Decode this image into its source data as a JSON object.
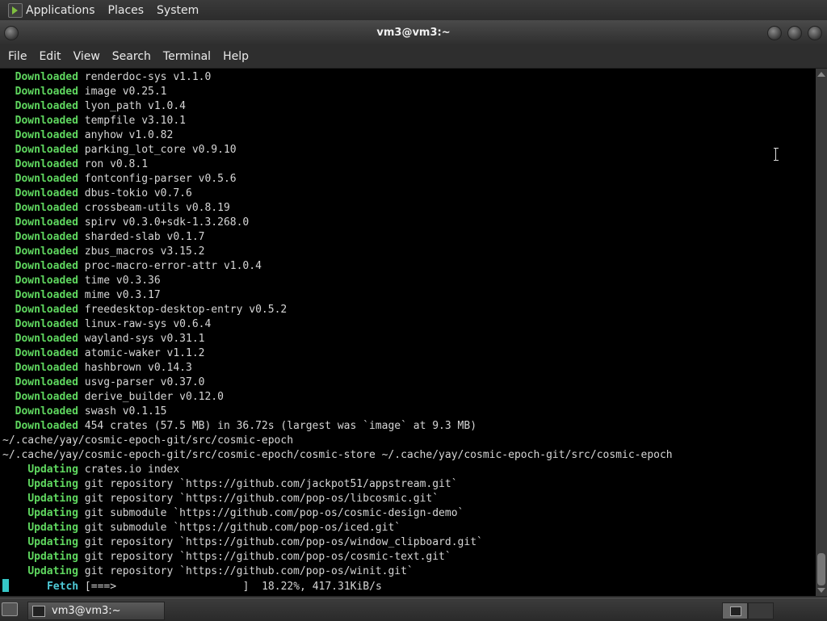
{
  "top_panel": {
    "menus": [
      "Applications",
      "Places",
      "System"
    ]
  },
  "window": {
    "title": "vm3@vm3:~"
  },
  "menubar": {
    "items": [
      "File",
      "Edit",
      "View",
      "Search",
      "Terminal",
      "Help"
    ]
  },
  "terminal": {
    "lines": [
      {
        "indent": "  ",
        "kw": "Downloaded",
        "text": " renderdoc-sys v1.1.0"
      },
      {
        "indent": "  ",
        "kw": "Downloaded",
        "text": " image v0.25.1"
      },
      {
        "indent": "  ",
        "kw": "Downloaded",
        "text": " lyon_path v1.0.4"
      },
      {
        "indent": "  ",
        "kw": "Downloaded",
        "text": " tempfile v3.10.1"
      },
      {
        "indent": "  ",
        "kw": "Downloaded",
        "text": " anyhow v1.0.82"
      },
      {
        "indent": "  ",
        "kw": "Downloaded",
        "text": " parking_lot_core v0.9.10"
      },
      {
        "indent": "  ",
        "kw": "Downloaded",
        "text": " ron v0.8.1"
      },
      {
        "indent": "  ",
        "kw": "Downloaded",
        "text": " fontconfig-parser v0.5.6"
      },
      {
        "indent": "  ",
        "kw": "Downloaded",
        "text": " dbus-tokio v0.7.6"
      },
      {
        "indent": "  ",
        "kw": "Downloaded",
        "text": " crossbeam-utils v0.8.19"
      },
      {
        "indent": "  ",
        "kw": "Downloaded",
        "text": " spirv v0.3.0+sdk-1.3.268.0"
      },
      {
        "indent": "  ",
        "kw": "Downloaded",
        "text": " sharded-slab v0.1.7"
      },
      {
        "indent": "  ",
        "kw": "Downloaded",
        "text": " zbus_macros v3.15.2"
      },
      {
        "indent": "  ",
        "kw": "Downloaded",
        "text": " proc-macro-error-attr v1.0.4"
      },
      {
        "indent": "  ",
        "kw": "Downloaded",
        "text": " time v0.3.36"
      },
      {
        "indent": "  ",
        "kw": "Downloaded",
        "text": " mime v0.3.17"
      },
      {
        "indent": "  ",
        "kw": "Downloaded",
        "text": " freedesktop-desktop-entry v0.5.2"
      },
      {
        "indent": "  ",
        "kw": "Downloaded",
        "text": " linux-raw-sys v0.6.4"
      },
      {
        "indent": "  ",
        "kw": "Downloaded",
        "text": " wayland-sys v0.31.1"
      },
      {
        "indent": "  ",
        "kw": "Downloaded",
        "text": " atomic-waker v1.1.2"
      },
      {
        "indent": "  ",
        "kw": "Downloaded",
        "text": " hashbrown v0.14.3"
      },
      {
        "indent": "  ",
        "kw": "Downloaded",
        "text": " usvg-parser v0.37.0"
      },
      {
        "indent": "  ",
        "kw": "Downloaded",
        "text": " derive_builder v0.12.0"
      },
      {
        "indent": "  ",
        "kw": "Downloaded",
        "text": " swash v0.1.15"
      },
      {
        "indent": "  ",
        "kw": "Downloaded",
        "text": " 454 crates (57.5 MB) in 36.72s (largest was `image` at 9.3 MB)"
      },
      {
        "indent": "",
        "kw": "",
        "text": "~/.cache/yay/cosmic-epoch-git/src/cosmic-epoch"
      },
      {
        "indent": "",
        "kw": "",
        "text": "~/.cache/yay/cosmic-epoch-git/src/cosmic-epoch/cosmic-store ~/.cache/yay/cosmic-epoch-git/src/cosmic-epoch"
      },
      {
        "indent": "    ",
        "kw": "Updating",
        "text": " crates.io index"
      },
      {
        "indent": "    ",
        "kw": "Updating",
        "text": " git repository `https://github.com/jackpot51/appstream.git`"
      },
      {
        "indent": "    ",
        "kw": "Updating",
        "text": " git repository `https://github.com/pop-os/libcosmic.git`"
      },
      {
        "indent": "    ",
        "kw": "Updating",
        "text": " git submodule `https://github.com/pop-os/cosmic-design-demo`"
      },
      {
        "indent": "    ",
        "kw": "Updating",
        "text": " git submodule `https://github.com/pop-os/iced.git`"
      },
      {
        "indent": "    ",
        "kw": "Updating",
        "text": " git repository `https://github.com/pop-os/window_clipboard.git`"
      },
      {
        "indent": "    ",
        "kw": "Updating",
        "text": " git repository `https://github.com/pop-os/cosmic-text.git`"
      },
      {
        "indent": "    ",
        "kw": "Updating",
        "text": " git repository `https://github.com/pop-os/winit.git`"
      }
    ],
    "progress_line": {
      "kw": "Fetch",
      "text": " [===>                    ]  18.22%, 417.31KiB/s"
    }
  },
  "taskbar": {
    "task_label": "vm3@vm3:~"
  },
  "colors": {
    "keyword": "#5fd75f",
    "fetch_keyword": "#4ec9d6",
    "cursor": "#35c6c6",
    "terminal_bg": "#000000"
  }
}
